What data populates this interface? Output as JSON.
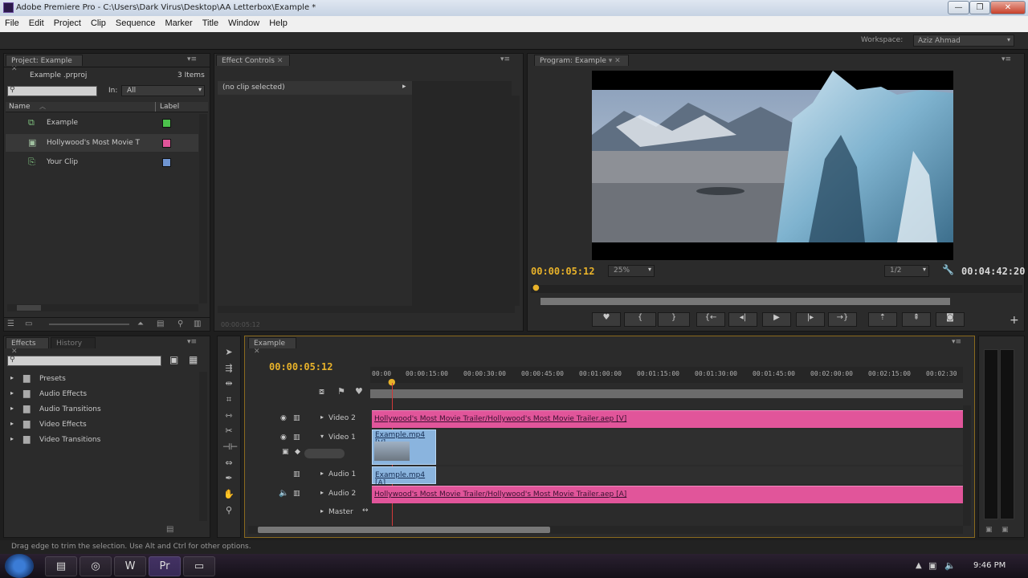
{
  "window": {
    "title": "Adobe Premiere Pro - C:\\Users\\Dark Virus\\Desktop\\AA Letterbox\\Example *"
  },
  "menu": [
    "File",
    "Edit",
    "Project",
    "Clip",
    "Sequence",
    "Marker",
    "Title",
    "Window",
    "Help"
  ],
  "workspace": {
    "label": "Workspace:",
    "value": "Aziz Ahmad"
  },
  "project_panel": {
    "tab": "Project: Example",
    "file": "Example .prproj",
    "item_count": "3 Items",
    "in_label": "In:",
    "in_value": "All",
    "columns": {
      "name": "Name",
      "label": "Label"
    },
    "items": [
      {
        "name": "Example",
        "color": "#4cc24c",
        "icon": "sequence-icon"
      },
      {
        "name": "Hollywood's Most Movie T",
        "color": "#e1559a",
        "icon": "film-icon"
      },
      {
        "name": "Your Clip",
        "color": "#6f95d1",
        "icon": "clip-icon"
      }
    ]
  },
  "effect_controls": {
    "tab": "Effect Controls",
    "no_clip": "(no clip selected)",
    "timecode": "00:00:05:12"
  },
  "program_monitor": {
    "tab": "Program: Example",
    "timecode": "00:00:05:12",
    "zoom": "25%",
    "resolution": "1/2",
    "duration": "00:04:42:20"
  },
  "effects_panel": {
    "tabs": [
      "Effects",
      "History"
    ],
    "folders": [
      "Presets",
      "Audio Effects",
      "Audio Transitions",
      "Video Effects",
      "Video Transitions"
    ]
  },
  "timeline": {
    "tab": "Example",
    "timecode": "00:00:05:12",
    "ruler": [
      "00:00",
      "00:00:15:00",
      "00:00:30:00",
      "00:00:45:00",
      "00:01:00:00",
      "00:01:15:00",
      "00:01:30:00",
      "00:01:45:00",
      "00:02:00:00",
      "00:02:15:00",
      "00:02:30"
    ],
    "tracks": {
      "video2": "Video 2",
      "video1": "Video 1",
      "audio1": "Audio 1",
      "audio2": "Audio 2",
      "master": "Master"
    },
    "clips": {
      "v2": "Hollywood's Most Movie Trailer/Hollywood's Most Movie Trailer.aep [V]",
      "v1": "Example.mp4 [V]",
      "a1": "Example.mp4 [A]",
      "a2": "Hollywood's Most Movie Trailer/Hollywood's Most Movie Trailer.aep [A]"
    }
  },
  "status_bar": {
    "text": "Drag edge to trim the selection. Use Alt and Ctrl for other options."
  },
  "taskbar": {
    "clock": "9:46 PM"
  },
  "colors": {
    "timecode": "#e8b22a",
    "clip_pink": "#e1559a",
    "clip_blue": "#8ab4de"
  }
}
